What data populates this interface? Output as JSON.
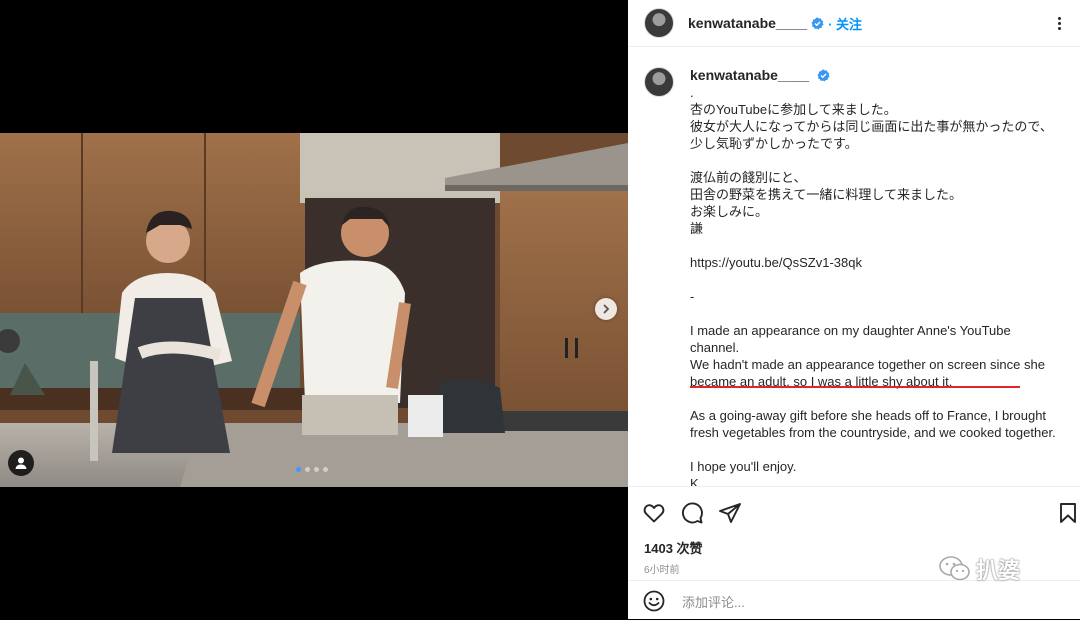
{
  "post": {
    "media": {
      "carousel": {
        "dot_count": 4,
        "active_index": 0
      }
    },
    "header": {
      "username": "kenwatanabe____",
      "follow_label": "关注"
    },
    "caption": {
      "username": "kenwatanabe____",
      "text": ".\n杏のYouTubeに参加して来ました。\n彼女が大人になってからは同じ画面に出た事が無かったので、\n少し気恥ずかしかったです。\n\n渡仏前の餞別にと、\n田舎の野菜を携えて一緒に料理して来ました。\nお楽しみに。\n謙\n\nhttps://youtu.be/QsSZv1-38qk\n\n-\n\nI made an appearance on my daughter Anne's YouTube channel.\nWe hadn't made an appearance together on screen since she became an adult, so I was a little shy about it.\n\nAs a going-away gift before she heads off to France, I brought fresh vegetables from the countryside, and we cooked together.\n\nI hope you'll enjoy.\nK"
    },
    "likes": "1403 次赞",
    "time": "6小时前",
    "comment_placeholder": "添加评论...",
    "watermark": "扒婆",
    "colors": {
      "accent": "#0095f6",
      "verified": "#3897f0",
      "annotation_underline": "#e0262a",
      "carousel_active_dot": "#3b9cff"
    },
    "icons": {
      "action_bar": [
        "heart-icon",
        "comment-icon",
        "share-icon",
        "bookmark-icon"
      ],
      "other": [
        "verified-badge-icon",
        "more-options-icon",
        "chevron-right-icon",
        "user-tag-icon",
        "emoji-icon",
        "wechat-icon"
      ]
    }
  }
}
